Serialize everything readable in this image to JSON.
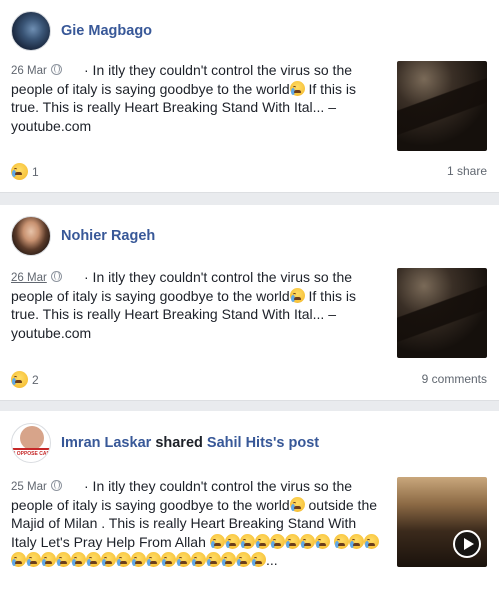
{
  "posts": [
    {
      "author": "Gie Magbago",
      "date": "26 Mar",
      "text_before": "· In itly they couldn't control the virus so the people of italy is saying goodbye to the world",
      "text_after": " If this is true. This is really Heart Breaking Stand With Ital... – youtube.com",
      "reaction_count": "1",
      "stat": "1 share",
      "thumbnail": "video-thumbnail"
    },
    {
      "author": "Nohier Rageh",
      "date": "26 Mar",
      "text_before": "· In itly they couldn't control the virus so the people of italy is saying goodbye to the world",
      "text_after": " If this is true. This is really Heart Breaking Stand With Ital... – youtube.com",
      "reaction_count": "2",
      "stat": "9 comments",
      "thumbnail": "video-thumbnail"
    },
    {
      "author": "Imran Laskar",
      "shared_word": "shared",
      "shared_target": "Sahil Hits's post",
      "avatar_badge": "I OPPOSE CAB",
      "date": "25 Mar",
      "text_before": "· In itly they couldn't control the virus so the people of italy is saying goodbye to the world",
      "text_after": " outside the Majid of Milan . This is really Heart Breaking Stand With Italy Let's Pray Help From Allah",
      "text_tail": "...",
      "thumbnail": "video-thumbnail-play"
    }
  ],
  "icons": {
    "privacy": "globe-icon",
    "reaction": "crying-face-icon",
    "play": "play-icon"
  },
  "colors": {
    "link": "#385898",
    "meta": "#616770",
    "background": "#e9ebee"
  }
}
